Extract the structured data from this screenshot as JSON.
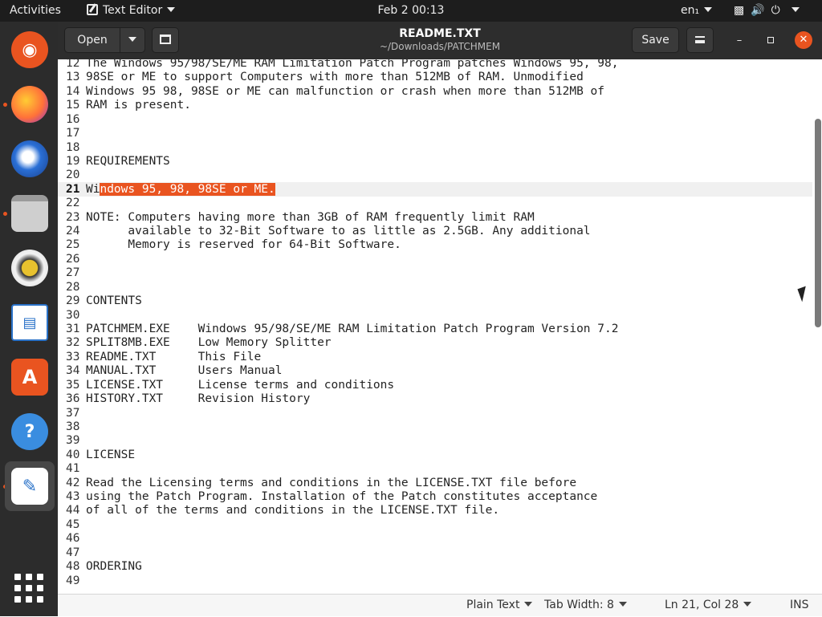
{
  "topbar": {
    "activities": "Activities",
    "app_menu": "Text Editor",
    "clock": "Feb 2  00:13",
    "input_method": "en₁"
  },
  "dock": {
    "items": [
      {
        "name": "Ubuntu Software Updater",
        "icon": "ubuntu-icon",
        "color": "#e95420"
      },
      {
        "name": "Firefox",
        "icon": "firefox-icon",
        "color": "#ff7139"
      },
      {
        "name": "Thunderbird",
        "icon": "thunderbird-icon",
        "color": "#2a6fd6"
      },
      {
        "name": "Files",
        "icon": "files-icon",
        "color": "#cfcfcf"
      },
      {
        "name": "Rhythmbox",
        "icon": "rhythmbox-icon",
        "color": "#e8c22e"
      },
      {
        "name": "LibreOffice Writer",
        "icon": "writer-icon",
        "color": "#2a72c8"
      },
      {
        "name": "Ubuntu Software",
        "icon": "software-center-icon",
        "color": "#e95420"
      },
      {
        "name": "Help",
        "icon": "help-icon",
        "color": "#3a8de0"
      },
      {
        "name": "Text Editor",
        "icon": "text-editor-icon",
        "color": "#ffffff"
      }
    ]
  },
  "header": {
    "open_label": "Open",
    "title": "README.TXT",
    "subtitle": "~/Downloads/PATCHMEM",
    "save_label": "Save"
  },
  "editor": {
    "current_line": 21,
    "lines": [
      {
        "n": "12",
        "text": "The Windows 95/98/SE/ME RAM Limitation Patch Program patches Windows 95, 98,"
      },
      {
        "n": "13",
        "text": "98SE or ME to support Computers with more than 512MB of RAM. Unmodified"
      },
      {
        "n": "14",
        "text": "Windows 95 98, 98SE or ME can malfunction or crash when more than 512MB of"
      },
      {
        "n": "15",
        "text": "RAM is present."
      },
      {
        "n": "16",
        "text": ""
      },
      {
        "n": "17",
        "text": ""
      },
      {
        "n": "18",
        "text": ""
      },
      {
        "n": "19",
        "text": "REQUIREMENTS"
      },
      {
        "n": "20",
        "text": ""
      },
      {
        "n": "21",
        "text": "Wi",
        "selected": "ndows 95, 98, 98SE or ME."
      },
      {
        "n": "22",
        "text": ""
      },
      {
        "n": "23",
        "text": "NOTE: Computers having more than 3GB of RAM frequently limit RAM"
      },
      {
        "n": "24",
        "text": "      available to 32-Bit Software to as little as 2.5GB. Any additional"
      },
      {
        "n": "25",
        "text": "      Memory is reserved for 64-Bit Software."
      },
      {
        "n": "26",
        "text": ""
      },
      {
        "n": "27",
        "text": ""
      },
      {
        "n": "28",
        "text": ""
      },
      {
        "n": "29",
        "text": "CONTENTS"
      },
      {
        "n": "30",
        "text": ""
      },
      {
        "n": "31",
        "text": "PATCHMEM.EXE    Windows 95/98/SE/ME RAM Limitation Patch Program Version 7.2"
      },
      {
        "n": "32",
        "text": "SPLIT8MB.EXE    Low Memory Splitter"
      },
      {
        "n": "33",
        "text": "README.TXT      This File"
      },
      {
        "n": "34",
        "text": "MANUAL.TXT      Users Manual"
      },
      {
        "n": "35",
        "text": "LICENSE.TXT     License terms and conditions"
      },
      {
        "n": "36",
        "text": "HISTORY.TXT     Revision History"
      },
      {
        "n": "37",
        "text": ""
      },
      {
        "n": "38",
        "text": ""
      },
      {
        "n": "39",
        "text": ""
      },
      {
        "n": "40",
        "text": "LICENSE"
      },
      {
        "n": "41",
        "text": ""
      },
      {
        "n": "42",
        "text": "Read the Licensing terms and conditions in the LICENSE.TXT file before"
      },
      {
        "n": "43",
        "text": "using the Patch Program. Installation of the Patch constitutes acceptance"
      },
      {
        "n": "44",
        "text": "of all of the terms and conditions in the LICENSE.TXT file."
      },
      {
        "n": "45",
        "text": ""
      },
      {
        "n": "46",
        "text": ""
      },
      {
        "n": "47",
        "text": ""
      },
      {
        "n": "48",
        "text": "ORDERING"
      },
      {
        "n": "49",
        "text": ""
      }
    ]
  },
  "statusbar": {
    "language": "Plain Text",
    "tab_width": "Tab Width: 8",
    "position": "Ln 21, Col 28",
    "mode": "INS"
  },
  "colors": {
    "accent": "#e95420",
    "topbar_bg": "#1d1d1d",
    "dock_bg": "#2c2c2c",
    "headerbar_bg": "#2d2d2d"
  }
}
